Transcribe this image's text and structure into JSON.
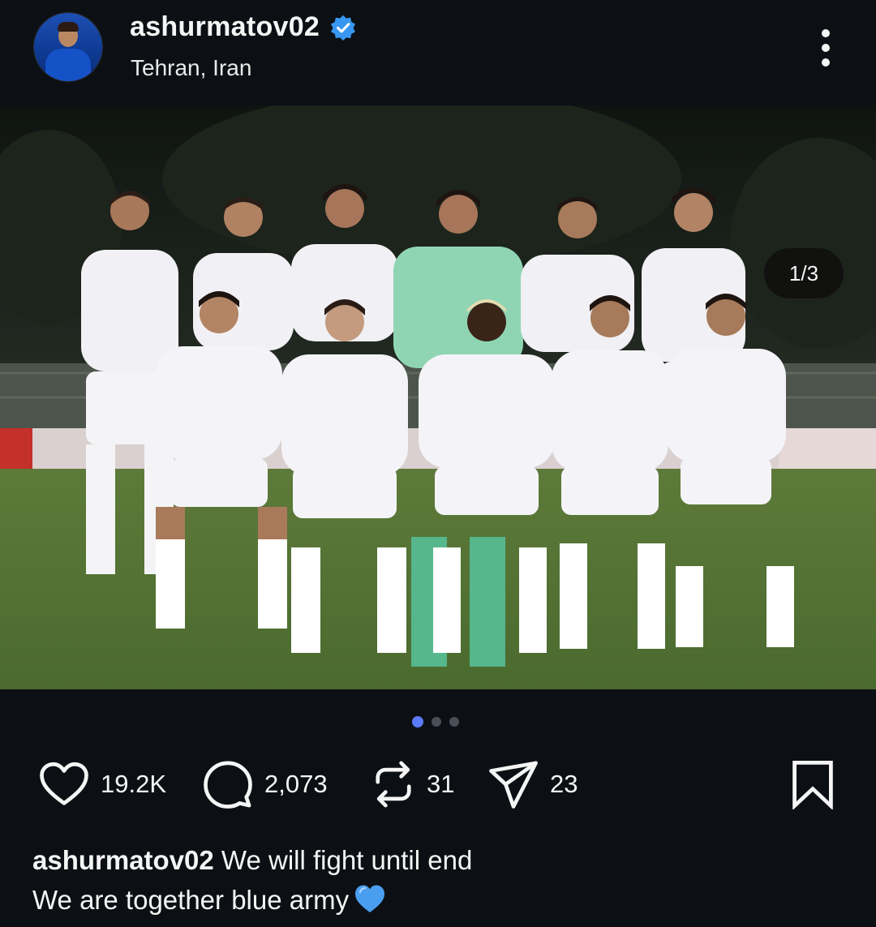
{
  "header": {
    "username": "ashurmatov02",
    "verified": true,
    "location": "Tehran, Iran",
    "more_icon": "more-vertical-icon"
  },
  "media": {
    "counter": "1/3",
    "current_slide": 1,
    "total_slides": 3
  },
  "actions": {
    "likes": "19.2K",
    "comments": "2,073",
    "reposts": "31",
    "shares": "23"
  },
  "caption": {
    "username": "ashurmatov02",
    "line1": " We will fight until end",
    "line2": "We are together blue army",
    "emoji": "blue-heart-emoji"
  },
  "colors": {
    "background": "#0c1014",
    "text": "#f5f5f5",
    "verified": "#3897f0",
    "active_dot": "#5b7bff",
    "inactive_dot": "#4a4f57"
  }
}
